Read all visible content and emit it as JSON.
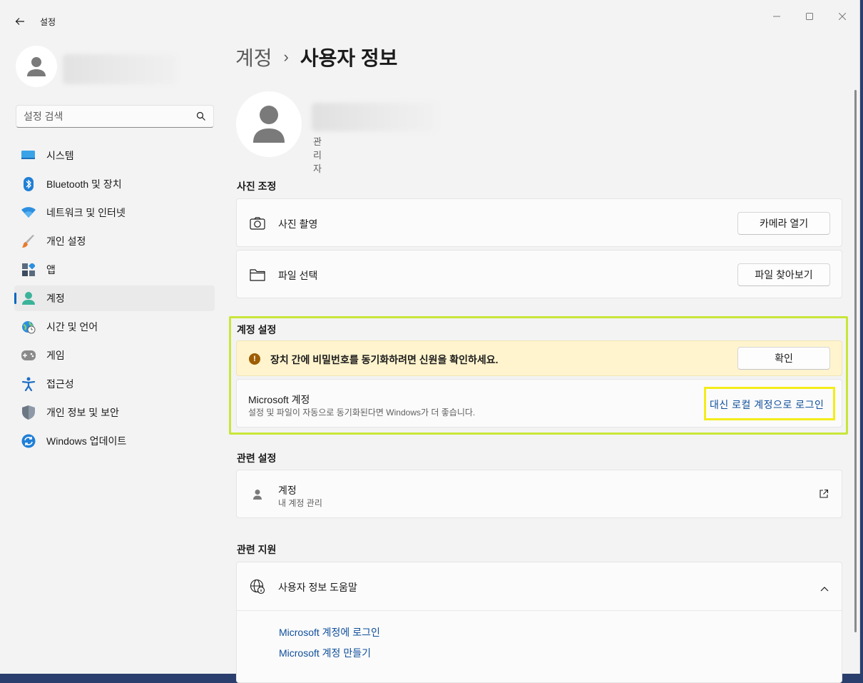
{
  "window": {
    "title": "설정"
  },
  "sidebar": {
    "search_placeholder": "설정 검색",
    "items": [
      {
        "label": "시스템",
        "icon": "monitor-icon"
      },
      {
        "label": "Bluetooth 및 장치",
        "icon": "bluetooth-icon"
      },
      {
        "label": "네트워크 및 인터넷",
        "icon": "wifi-icon"
      },
      {
        "label": "개인 설정",
        "icon": "brush-icon"
      },
      {
        "label": "앱",
        "icon": "apps-icon"
      },
      {
        "label": "계정",
        "icon": "account-icon",
        "active": true
      },
      {
        "label": "시간 및 언어",
        "icon": "globe-clock-icon"
      },
      {
        "label": "게임",
        "icon": "gamepad-icon"
      },
      {
        "label": "접근성",
        "icon": "accessibility-icon"
      },
      {
        "label": "개인 정보 및 보안",
        "icon": "shield-icon"
      },
      {
        "label": "Windows 업데이트",
        "icon": "update-icon"
      }
    ]
  },
  "breadcrumb": {
    "parent": "계정",
    "separator": "›",
    "current": "사용자 정보"
  },
  "user": {
    "role": "관리자"
  },
  "photo": {
    "section_title": "사진 조정",
    "take_photo_label": "사진 촬영",
    "open_camera_button": "카메라 열기",
    "choose_file_label": "파일 선택",
    "browse_button": "파일 찾아보기"
  },
  "account_settings": {
    "section_title": "계정 설정",
    "warning_text": "장치 간에 비밀번호를 동기화하려면 신원을 확인하세요.",
    "verify_button": "확인",
    "ms_title": "Microsoft 계정",
    "ms_subtitle": "설정 및 파일이 자동으로 동기화된다면 Windows가 더 좋습니다.",
    "local_link": "대신 로컬 계정으로 로그인"
  },
  "related_settings": {
    "section_title": "관련 설정",
    "accounts_title": "계정",
    "accounts_sub": "내 계정 관리"
  },
  "related_support": {
    "section_title": "관련 지원",
    "help_title": "사용자 정보 도움말",
    "link1": "Microsoft 계정에 로그인",
    "link2": "Microsoft 계정 만들기"
  },
  "colors": {
    "accent": "#0067c0",
    "link": "#0f4f9b",
    "warning_bg": "#fff4ce",
    "highlight_green": "#c8e63a",
    "highlight_yellow": "#f4ec1a"
  }
}
